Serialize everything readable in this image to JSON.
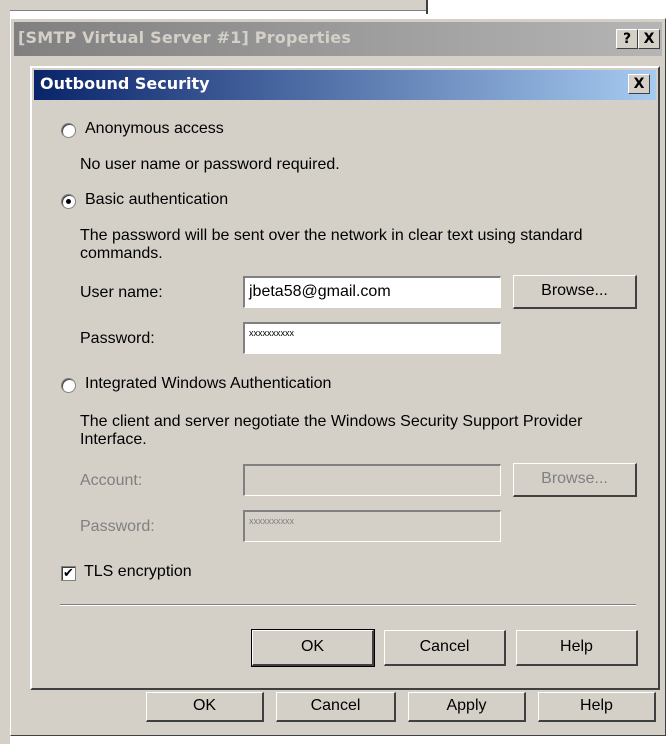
{
  "parent_window": {
    "title": "[SMTP Virtual Server #1] Properties",
    "help_button": "?",
    "close_button": "X",
    "buttons": {
      "ok": "OK",
      "cancel": "Cancel",
      "apply": "Apply",
      "help": "Help"
    }
  },
  "dialog": {
    "title": "Outbound Security",
    "close_button": "X",
    "anonymous": {
      "label": "Anonymous access",
      "description": "No user name or password required.",
      "selected": false
    },
    "basic": {
      "label": "Basic authentication",
      "description_line1": "The password will be sent over the network in clear text using standard",
      "description_line2": "commands.",
      "selected": true,
      "username_label": "User name:",
      "username_value": "jbeta58@gmail.com",
      "password_label": "Password:",
      "password_value": "xxxxxxxxxx",
      "browse_label": "Browse..."
    },
    "integrated": {
      "label": "Integrated Windows Authentication",
      "description_line1": "The client and server negotiate the Windows Security Support Provider",
      "description_line2": "Interface.",
      "selected": false,
      "account_label": "Account:",
      "account_value": "",
      "password_label": "Password:",
      "password_value": "xxxxxxxxxx",
      "browse_label": "Browse..."
    },
    "tls": {
      "label": "TLS encryption",
      "checked": true,
      "mark": "✔"
    },
    "buttons": {
      "ok": "OK",
      "cancel": "Cancel",
      "help": "Help"
    }
  },
  "colors": {
    "dialog_face": "#d4d0c8",
    "active_title": "#0a246a",
    "inactive_title": "#808080"
  }
}
